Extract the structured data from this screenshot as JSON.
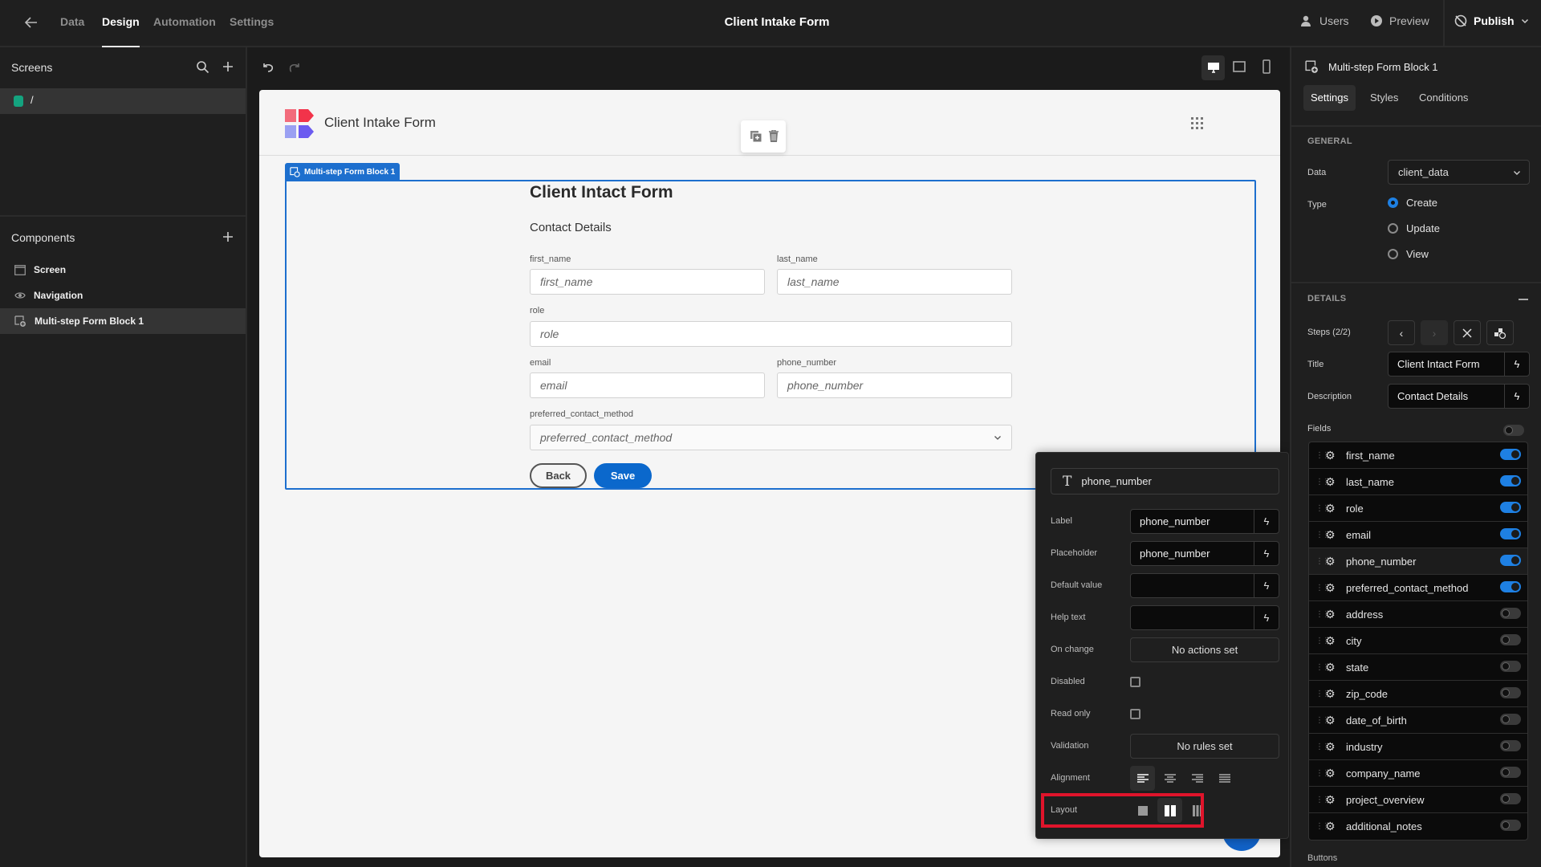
{
  "topbar": {
    "nav_tabs": [
      "Data",
      "Design",
      "Automation",
      "Settings"
    ],
    "active_tab": "Design",
    "app_title": "Client Intake Form",
    "users_label": "Users",
    "preview_label": "Preview",
    "publish_label": "Publish"
  },
  "left_panel": {
    "screens_title": "Screens",
    "screens": [
      {
        "route": "/",
        "color": "#14a37f"
      }
    ],
    "components_title": "Components",
    "components": [
      {
        "label": "Screen",
        "icon": "screen-icon"
      },
      {
        "label": "Navigation",
        "icon": "eye-icon"
      },
      {
        "label": "Multi-step Form Block 1",
        "icon": "form-block-icon",
        "selected": true
      }
    ]
  },
  "canvas": {
    "app_header_title": "Client Intake Form",
    "block_tag": "Multi-step Form Block 1",
    "form": {
      "title": "Client Intact Form",
      "description": "Contact Details",
      "fields": [
        {
          "label": "first_name",
          "placeholder": "first_name"
        },
        {
          "label": "last_name",
          "placeholder": "last_name"
        },
        {
          "label": "role",
          "placeholder": "role"
        },
        {
          "label": "email",
          "placeholder": "email"
        },
        {
          "label": "phone_number",
          "placeholder": "phone_number"
        },
        {
          "label": "preferred_contact_method",
          "placeholder": "preferred_contact_method"
        }
      ],
      "back_label": "Back",
      "save_label": "Save"
    }
  },
  "field_popover": {
    "field_name": "phone_number",
    "label_label": "Label",
    "label_value": "phone_number",
    "placeholder_label": "Placeholder",
    "placeholder_value": "phone_number",
    "default_value_label": "Default value",
    "default_value": "",
    "help_text_label": "Help text",
    "help_text": "",
    "on_change_label": "On change",
    "on_change_value": "No actions set",
    "disabled_label": "Disabled",
    "disabled": false,
    "read_only_label": "Read only",
    "read_only": false,
    "validation_label": "Validation",
    "validation_value": "No rules set",
    "alignment_label": "Alignment",
    "alignment_selected": "left",
    "layout_label": "Layout",
    "layout_selected": "two-column",
    "highlight_color": "#e0142b"
  },
  "right_panel": {
    "component_title": "Multi-step Form Block 1",
    "tabs": [
      "Settings",
      "Styles",
      "Conditions"
    ],
    "active_tab": "Settings",
    "general": {
      "section_title": "GENERAL",
      "data_label": "Data",
      "data_value": "client_data",
      "type_label": "Type",
      "type_options": [
        "Create",
        "Update",
        "View"
      ],
      "type_selected": "Create"
    },
    "details": {
      "section_title": "DETAILS",
      "steps_label": "Steps (2/2)",
      "title_label": "Title",
      "title_value": "Client Intact Form",
      "description_label": "Description",
      "description_value": "Contact Details",
      "fields_label": "Fields",
      "fields": [
        {
          "name": "first_name",
          "enabled": true
        },
        {
          "name": "last_name",
          "enabled": true
        },
        {
          "name": "role",
          "enabled": true
        },
        {
          "name": "email",
          "enabled": true
        },
        {
          "name": "phone_number",
          "enabled": true
        },
        {
          "name": "preferred_contact_method",
          "enabled": true
        },
        {
          "name": "address",
          "enabled": false
        },
        {
          "name": "city",
          "enabled": false
        },
        {
          "name": "state",
          "enabled": false
        },
        {
          "name": "zip_code",
          "enabled": false
        },
        {
          "name": "date_of_birth",
          "enabled": false
        },
        {
          "name": "industry",
          "enabled": false
        },
        {
          "name": "company_name",
          "enabled": false
        },
        {
          "name": "project_overview",
          "enabled": false
        },
        {
          "name": "additional_notes",
          "enabled": false
        }
      ],
      "buttons_label": "Buttons"
    },
    "accent_color": "#1e80e3"
  }
}
